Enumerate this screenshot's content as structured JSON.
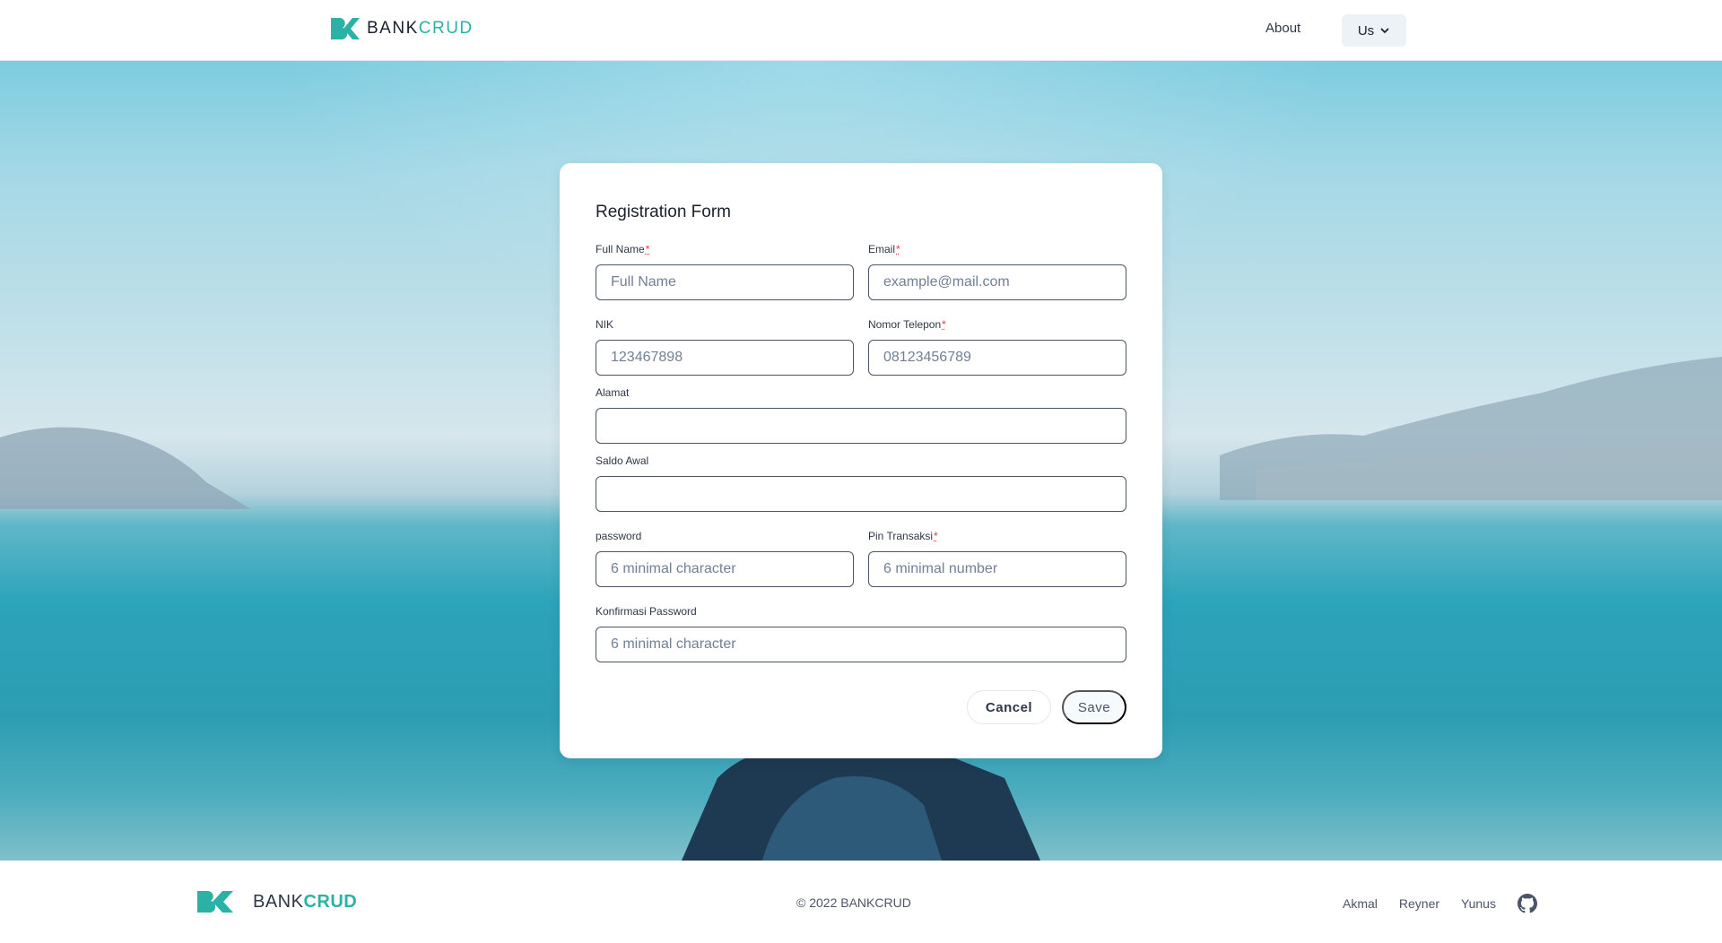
{
  "header": {
    "brand_prefix": "BANK",
    "brand_accent": "CRUD",
    "nav_about": "About",
    "nav_us": "Us"
  },
  "form": {
    "title": "Registration Form",
    "required_mark": "*",
    "fields": {
      "full_name": {
        "label": "Full Name",
        "placeholder": "Full Name",
        "value": ""
      },
      "email": {
        "label": "Email",
        "placeholder": "example@mail.com",
        "value": ""
      },
      "nik": {
        "label": "NIK",
        "placeholder": "123467898",
        "value": ""
      },
      "phone": {
        "label": "Nomor Telepon",
        "placeholder": "08123456789",
        "value": ""
      },
      "address": {
        "label": "Alamat",
        "placeholder": "",
        "value": ""
      },
      "initial_balance": {
        "label": "Saldo Awal",
        "placeholder": "",
        "value": ""
      },
      "password": {
        "label": "password",
        "placeholder": "6 minimal character",
        "value": ""
      },
      "pin": {
        "label": "Pin Transaksi",
        "placeholder": "6 minimal number",
        "value": ""
      },
      "confirm_password": {
        "label": "Konfirmasi Password",
        "placeholder": "6 minimal character",
        "value": ""
      }
    },
    "cancel_label": "Cancel",
    "save_label": "Save"
  },
  "footer": {
    "brand_prefix": "BANK",
    "brand_accent": "CRUD",
    "copyright": "© 2022 BANKCRUD",
    "links": [
      "Akmal",
      "Reyner",
      "Yunus"
    ]
  },
  "colors": {
    "accent": "#2cb1a6",
    "input_border": "#4a5568",
    "required": "#e53e3e"
  },
  "icons": {
    "brand_logo": "bc-logo-icon",
    "dropdown": "chevron-down-icon",
    "github": "github-icon"
  }
}
